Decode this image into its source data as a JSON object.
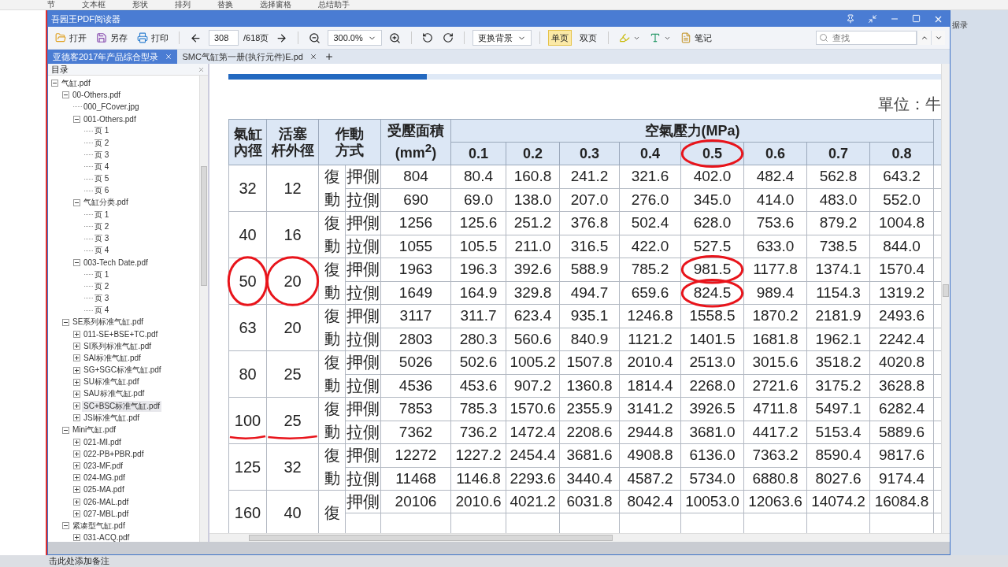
{
  "ribbon": [
    "节",
    "文本框",
    "形状",
    "排列",
    "替换",
    "选择窗格",
    "总结助手"
  ],
  "desktop_label": "据录",
  "window": {
    "title": "吾园王PDF阅读器"
  },
  "toolbar": {
    "open": "打开",
    "save_as": "另存",
    "print": "打印",
    "page": "308",
    "page_total": "/618页",
    "zoom": "300.0%",
    "background": "更换背景",
    "view_modes": [
      {
        "label": "单页",
        "selected": true
      },
      {
        "label": "双页",
        "selected": false
      }
    ],
    "note": "笔记",
    "search_placeholder": "查找"
  },
  "tabs": [
    {
      "label": "亚德客2017年产品综合型录",
      "selected": true
    },
    {
      "label": "SMC气缸第一册(执行元件)E.pd",
      "selected": false
    }
  ],
  "sidebar": {
    "title": "目录",
    "tree": [
      {
        "label": "气缸.pdf",
        "expanded": true,
        "selected": false,
        "children": [
          {
            "label": "00-Others.pdf",
            "expanded": true,
            "selected": false,
            "children": [
              {
                "label": "000_FCover.jpg",
                "selected": false
              },
              {
                "label": "001-Others.pdf",
                "expanded": true,
                "selected": false,
                "children": [
                  {
                    "label": "页 1",
                    "selected": false
                  },
                  {
                    "label": "页 2",
                    "selected": false
                  },
                  {
                    "label": "页 3",
                    "selected": false
                  },
                  {
                    "label": "页 4",
                    "selected": false
                  },
                  {
                    "label": "页 5",
                    "selected": false
                  },
                  {
                    "label": "页 6",
                    "selected": false
                  }
                ]
              },
              {
                "label": "气缸分类.pdf",
                "expanded": true,
                "selected": false,
                "children": [
                  {
                    "label": "页 1",
                    "selected": false
                  },
                  {
                    "label": "页 2",
                    "selected": false
                  },
                  {
                    "label": "页 3",
                    "selected": false
                  },
                  {
                    "label": "页 4",
                    "selected": false
                  }
                ]
              },
              {
                "label": "003-Tech Date.pdf",
                "expanded": true,
                "selected": false,
                "children": [
                  {
                    "label": "页 1",
                    "selected": false
                  },
                  {
                    "label": "页 2",
                    "selected": false
                  },
                  {
                    "label": "页 3",
                    "selected": false
                  },
                  {
                    "label": "页 4",
                    "selected": false
                  }
                ]
              }
            ]
          },
          {
            "label": "SE系列标准气缸.pdf",
            "expanded": true,
            "selected": false,
            "children": [
              {
                "label": "011-SE+BSE+TC.pdf",
                "expanded": false,
                "selected": false
              },
              {
                "label": "SI系列标准气缸.pdf",
                "expanded": false,
                "selected": false
              },
              {
                "label": "SAI标准气缸.pdf",
                "expanded": false,
                "selected": false
              },
              {
                "label": "SG+SGC标准气缸.pdf",
                "expanded": false,
                "selected": false
              },
              {
                "label": "SU标准气缸.pdf",
                "expanded": false,
                "selected": false
              },
              {
                "label": "SAU标准气缸.pdf",
                "expanded": false,
                "selected": false
              },
              {
                "label": "SC+BSC标准气缸.pdf",
                "expanded": false,
                "selected": true
              },
              {
                "label": "JSI标准气缸.pdf",
                "expanded": false,
                "selected": false
              }
            ]
          },
          {
            "label": "Mini气缸.pdf",
            "expanded": true,
            "selected": false,
            "children": [
              {
                "label": "021-MI.pdf",
                "expanded": false,
                "selected": false
              },
              {
                "label": "022-PB+PBR.pdf",
                "expanded": false,
                "selected": false
              },
              {
                "label": "023-MF.pdf",
                "expanded": false,
                "selected": false
              },
              {
                "label": "024-MG.pdf",
                "expanded": false,
                "selected": false
              },
              {
                "label": "025-MA.pdf",
                "expanded": false,
                "selected": false
              },
              {
                "label": "026-MAL.pdf",
                "expanded": false,
                "selected": false
              },
              {
                "label": "027-MBL.pdf",
                "expanded": false,
                "selected": false
              }
            ]
          },
          {
            "label": "紧凑型气缸.pdf",
            "expanded": true,
            "selected": false,
            "children": [
              {
                "label": "031-ACQ.pdf",
                "expanded": false,
                "selected": false
              }
            ]
          }
        ]
      }
    ]
  },
  "document": {
    "unit": "單位：牛",
    "headers": {
      "bore": [
        "氣缸",
        "內徑"
      ],
      "rod": [
        "活塞",
        "杆外徑"
      ],
      "action": [
        "作動",
        "方式"
      ],
      "area": [
        "受壓面積",
        "(mm$^{2}$)"
      ],
      "pressure": "空氣壓力(MPa)"
    },
    "pressures": [
      {
        "label": "0.1",
        "circled": false
      },
      {
        "label": "0.2",
        "circled": false
      },
      {
        "label": "0.3",
        "circled": false
      },
      {
        "label": "0.4",
        "circled": false
      },
      {
        "label": "0.5",
        "circled": true
      },
      {
        "label": "0.6",
        "circled": false
      },
      {
        "label": "0.7",
        "circled": false
      },
      {
        "label": "0.8",
        "circled": false
      }
    ],
    "rows": [
      {
        "bore": "32",
        "rod": "12",
        "action": "復動",
        "push": {
          "side": "押側",
          "area": "804",
          "values": [
            "80.4",
            "160.8",
            "241.2",
            "321.6",
            "402.0",
            "482.4",
            "562.8",
            "643.2"
          ]
        },
        "pull": {
          "side": "拉側",
          "area": "690",
          "values": [
            "69.0",
            "138.0",
            "207.0",
            "276.0",
            "345.0",
            "414.0",
            "483.0",
            "552.0"
          ]
        }
      },
      {
        "bore": "40",
        "rod": "16",
        "action": "復動",
        "push": {
          "side": "押側",
          "area": "1256",
          "values": [
            "125.6",
            "251.2",
            "376.8",
            "502.4",
            "628.0",
            "753.6",
            "879.2",
            "1004.8"
          ]
        },
        "pull": {
          "side": "拉側",
          "area": "1055",
          "values": [
            "105.5",
            "211.0",
            "316.5",
            "422.0",
            "527.5",
            "633.0",
            "738.5",
            "844.0"
          ]
        }
      },
      {
        "bore": "50",
        "rod": "20",
        "action": "復動",
        "bore_circled": true,
        "rod_circled": true,
        "push": {
          "side": "押側",
          "area": "1963",
          "values": [
            "196.3",
            "392.6",
            "588.9",
            "785.2",
            "981.5",
            "1177.8",
            "1374.1",
            "1570.4"
          ],
          "circled": [
            false,
            false,
            false,
            false,
            true,
            false,
            false,
            false
          ]
        },
        "pull": {
          "side": "拉側",
          "area": "1649",
          "values": [
            "164.9",
            "329.8",
            "494.7",
            "659.6",
            "824.5",
            "989.4",
            "1154.3",
            "1319.2"
          ],
          "circled": [
            false,
            false,
            false,
            false,
            true,
            false,
            false,
            false
          ]
        }
      },
      {
        "bore": "63",
        "rod": "20",
        "action": "復動",
        "push": {
          "side": "押側",
          "area": "3117",
          "values": [
            "311.7",
            "623.4",
            "935.1",
            "1246.8",
            "1558.5",
            "1870.2",
            "2181.9",
            "2493.6"
          ]
        },
        "pull": {
          "side": "拉側",
          "area": "2803",
          "values": [
            "280.3",
            "560.6",
            "840.9",
            "1121.2",
            "1401.5",
            "1681.8",
            "1962.1",
            "2242.4"
          ]
        }
      },
      {
        "bore": "80",
        "rod": "25",
        "action": "復動",
        "push": {
          "side": "押側",
          "area": "5026",
          "values": [
            "502.6",
            "1005.2",
            "1507.8",
            "2010.4",
            "2513.0",
            "3015.6",
            "3518.2",
            "4020.8"
          ]
        },
        "pull": {
          "side": "拉側",
          "area": "4536",
          "values": [
            "453.6",
            "907.2",
            "1360.8",
            "1814.4",
            "2268.0",
            "2721.6",
            "3175.2",
            "3628.8"
          ]
        }
      },
      {
        "bore": "100",
        "rod": "25",
        "action": "復動",
        "bore_underlined": true,
        "rod_underlined": true,
        "push": {
          "side": "押側",
          "area": "7853",
          "values": [
            "785.3",
            "1570.6",
            "2355.9",
            "3141.2",
            "3926.5",
            "4711.8",
            "5497.1",
            "6282.4"
          ]
        },
        "pull": {
          "side": "拉側",
          "area": "7362",
          "values": [
            "736.2",
            "1472.4",
            "2208.6",
            "2944.8",
            "3681.0",
            "4417.2",
            "5153.4",
            "5889.6"
          ]
        }
      },
      {
        "bore": "125",
        "rod": "32",
        "action": "復動",
        "push": {
          "side": "押側",
          "area": "12272",
          "values": [
            "1227.2",
            "2454.4",
            "3681.6",
            "4908.8",
            "6136.0",
            "7363.2",
            "8590.4",
            "9817.6"
          ]
        },
        "pull": {
          "side": "拉側",
          "area": "11468",
          "values": [
            "1146.8",
            "2293.6",
            "3440.4",
            "4587.2",
            "5734.0",
            "6880.8",
            "8027.6",
            "9174.4"
          ]
        }
      },
      {
        "bore": "160",
        "rod": "40",
        "action": "復",
        "push": {
          "side": "押側",
          "area": "20106",
          "values": [
            "2010.6",
            "4021.2",
            "6031.8",
            "8042.4",
            "10053.0",
            "12063.6",
            "14074.2",
            "16084.8"
          ]
        }
      }
    ]
  },
  "notes_placeholder": "击此处添加备注"
}
